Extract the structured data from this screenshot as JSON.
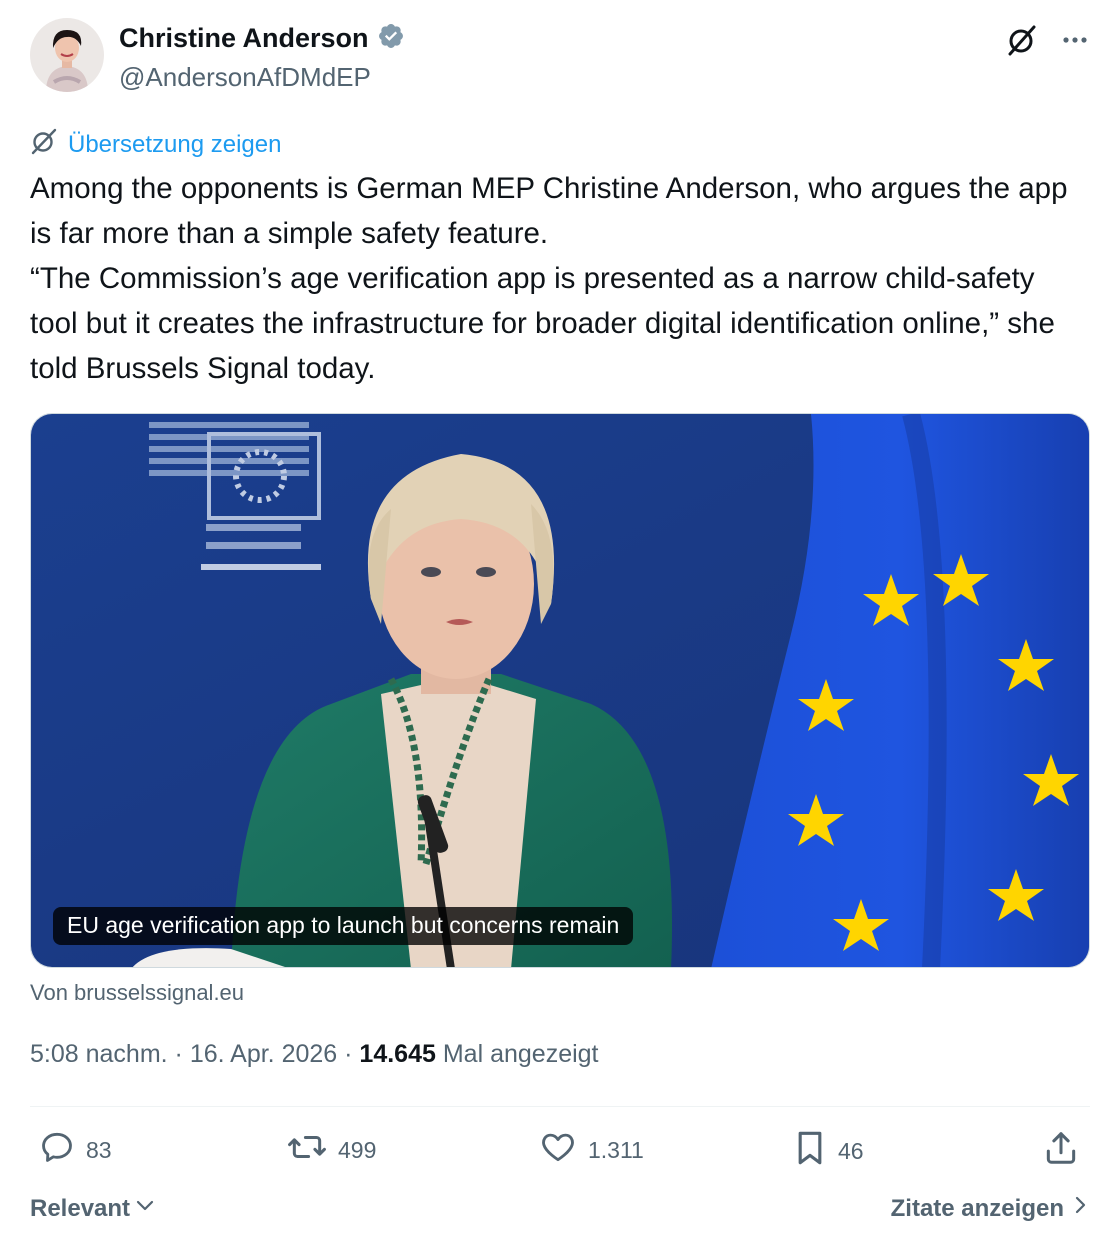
{
  "author": {
    "name": "Christine Anderson",
    "handle": "@AndersonAfDMdEP",
    "verified": true,
    "verified_color": "#829aab"
  },
  "translate_label": "Übersetzung zeigen",
  "tweet": {
    "paragraph1": "Among the opponents is German MEP Christine Anderson, who argues the app is far more than a simple safety feature.",
    "paragraph2": "“The Commission’s age verification app is presented as a narrow child-safety tool but it creates the infrastructure for broader digital identification online,” she told Brussels Signal today."
  },
  "card": {
    "title": "EU age verification app to launch but concerns remain",
    "source": "Von brusselssignal.eu",
    "image_icon": "press-conference-photo"
  },
  "meta": {
    "time": "5:08 nachm.",
    "separator": "·",
    "date": "16. Apr. 2026",
    "views": "14.645",
    "views_label": "Mal angezeigt"
  },
  "actions": {
    "replies": "83",
    "reposts": "499",
    "likes": "1.311",
    "bookmarks": "46"
  },
  "footer": {
    "sort_label": "Relevant",
    "quotes_label": "Zitate anzeigen"
  },
  "colors": {
    "accent": "#1d9bf0",
    "text": "#0f1419",
    "muted": "#536471",
    "eu_blue": "#1f47c4",
    "eu_star": "#ffd500"
  },
  "icons": [
    "verified-badge-icon",
    "grok-icon",
    "more-icon",
    "translate-icon",
    "reply-icon",
    "repost-icon",
    "like-icon",
    "bookmark-icon",
    "share-icon",
    "chevron-down-icon",
    "chevron-right-icon"
  ]
}
